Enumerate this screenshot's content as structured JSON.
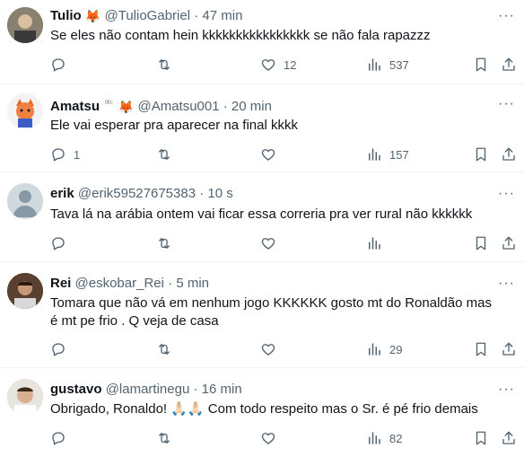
{
  "tweets": [
    {
      "name": "Tulio",
      "emoji": "🦊",
      "badge": "",
      "handle": "@TulioGabriel",
      "time": "47 min",
      "text": "Se eles não contam hein kkkkkkkkkkkkkkkk se não fala rapazzz",
      "replies": "",
      "retweets": "",
      "likes": "12",
      "views": "537",
      "avatar_color": "#7a7060"
    },
    {
      "name": "Amatsu",
      "emoji": "🦊",
      "badge": "ᴰᴱᶜ",
      "handle": "@Amatsu001",
      "time": "20 min",
      "text": "Ele vai esperar pra aparecer na final kkkk",
      "replies": "1",
      "retweets": "",
      "likes": "",
      "views": "157",
      "avatar_color": "#e86a2a"
    },
    {
      "name": "erik",
      "emoji": "",
      "badge": "",
      "handle": "@erik59527675383",
      "time": "10 s",
      "text": "Tava lá na arábia ontem vai ficar essa correria pra ver rural não kkkkkk",
      "replies": "",
      "retweets": "",
      "likes": "",
      "views": "",
      "avatar_color": "#cfd9de"
    },
    {
      "name": "Rei",
      "emoji": "",
      "badge": "",
      "handle": "@eskobar_Rei",
      "time": "5 min",
      "text": "Tomara que não vá em nenhum jogo KKKKKK gosto mt do Ronaldão mas é mt pe frio . Q veja de casa",
      "replies": "",
      "retweets": "",
      "likes": "",
      "views": "29",
      "avatar_color": "#6b4a3a"
    },
    {
      "name": "gustavo",
      "emoji": "",
      "badge": "",
      "handle": "@lamartinegu",
      "time": "16 min",
      "text": "Obrigado, Ronaldo! 🙏🏻🙏🏻 Com todo respeito mas o Sr. é pé frio demais",
      "replies": "",
      "retweets": "",
      "likes": "",
      "views": "82",
      "avatar_color": "#c9a98a"
    }
  ],
  "separator": "·",
  "more_glyph": "···",
  "icons": {
    "reply": "reply-icon",
    "retweet": "retweet-icon",
    "like": "heart-icon",
    "views": "views-icon",
    "bookmark": "bookmark-icon",
    "share": "share-icon"
  }
}
